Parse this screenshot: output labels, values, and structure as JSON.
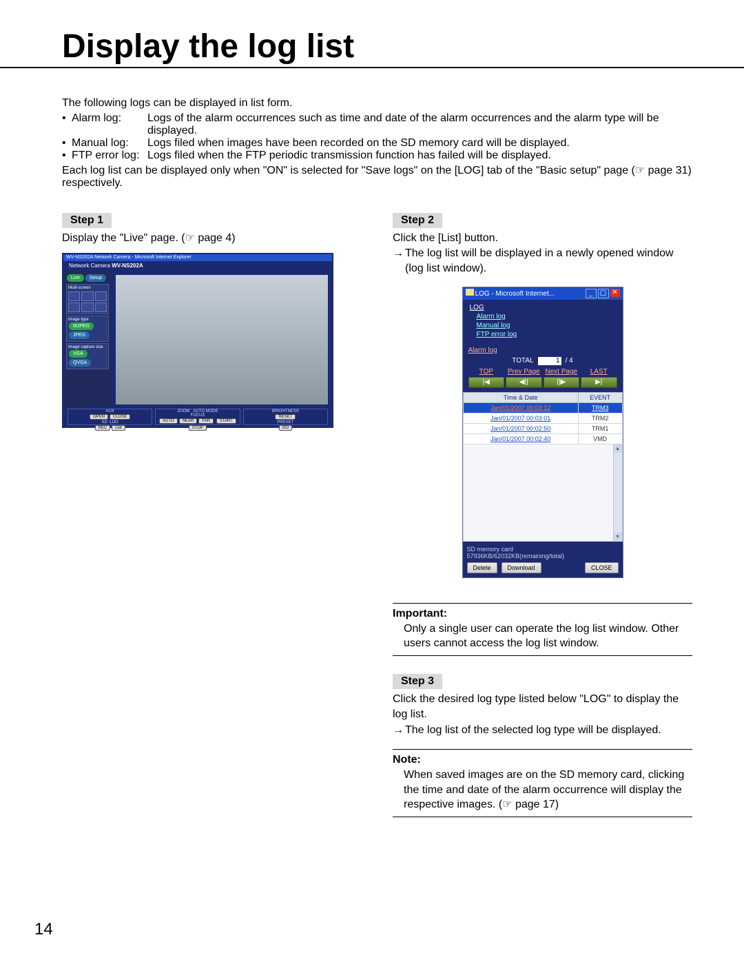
{
  "title": "Display the log list",
  "intro": "The following logs can be displayed in list form.",
  "log_types": [
    {
      "name": "Alarm log:",
      "desc": "Logs of the alarm occurrences such as time and date of the alarm occurrences and the alarm type will be displayed."
    },
    {
      "name": "Manual log:",
      "desc": "Logs filed when images have been recorded on the SD memory card will be displayed."
    },
    {
      "name": "FTP error log:",
      "desc": "Logs filed when the FTP periodic transmission function has failed will be displayed."
    }
  ],
  "footnote": "Each log list can be displayed only when \"ON\" is selected for \"Save logs\" on the [LOG] tab of the \"Basic setup\" page (☞ page 31) respectively.",
  "step1": {
    "label": "Step 1",
    "text": "Display the \"Live\" page. (☞ page 4)"
  },
  "step2": {
    "label": "Step 2",
    "line1": "Click the [List] button.",
    "line2": "→ The log list will be displayed in a newly opened window (log list window)."
  },
  "step3": {
    "label": "Step 3",
    "line1": "Click the desired log type listed below \"LOG\" to display the log list.",
    "line2": "→ The log list of the selected log type will be displayed."
  },
  "important": {
    "hd": "Important:",
    "body": "Only a single user can operate the log list window. Other users cannot access the log list window."
  },
  "note": {
    "hd": "Note:",
    "body": "When saved images are on the SD memory card, clicking the time and date of the alarm occurrence will display the respective images. (☞ page 17)"
  },
  "page_number": "14",
  "live_window": {
    "titlebar": "WV-NS202A Network Camera - Microsoft Internet Explorer",
    "model": "WV-NS202A",
    "live_btn": "Live",
    "setup_btn": "Setup",
    "multiscreen": "Multi-screen",
    "image_type": "Image type",
    "mjpeg": "MJPEG",
    "jpeg": "JPEG",
    "capture_size": "Image capture size",
    "vga": "VGA",
    "qvga": "QVGA",
    "aux": "AUX",
    "open": "OPEN",
    "close": "CLOSE",
    "sd": "SD",
    "log": "LOG",
    "rec": "REC",
    "list": "List",
    "zoom": "ZOOM",
    "automode": "AUTO MODE",
    "focus": "FOCUS",
    "auto": "AUTO",
    "near": "NEAR",
    "far": "FAR",
    "start": "START",
    "stop": "STOP",
    "brightness": "BRIGHTNESS",
    "reset": "RESET",
    "preset": "PRESET",
    "go": "GO"
  },
  "log_window": {
    "title": "LOG - Microsoft Internet...",
    "heading": "LOG",
    "links": [
      "Alarm log",
      "Manual log",
      "FTP error log"
    ],
    "section": "Alarm log",
    "total_label": "TOTAL",
    "total_value": "1",
    "total_of": "/ 4",
    "pager": [
      "TOP",
      "Prev Page",
      "Next Page",
      "LAST"
    ],
    "pager_icons": [
      "|◀",
      "◀||",
      "||▶",
      "▶|"
    ],
    "cols": [
      "Time & Date",
      "EVENT"
    ],
    "rows": [
      {
        "t": "Jan/01/2007 00:03:12",
        "e": "TRM3",
        "sel": true
      },
      {
        "t": "Jan/01/2007 00:03:01",
        "e": "TRM2"
      },
      {
        "t": "Jan/01/2007 00:02:50",
        "e": "TRM1"
      },
      {
        "t": "Jan/01/2007 00:02:40",
        "e": "VMD"
      }
    ],
    "sd_label": "SD memory card",
    "sd_stats": "57936KB/62032KB(remaining/total)",
    "buttons": [
      "Delete",
      "Download",
      "CLOSE"
    ]
  }
}
